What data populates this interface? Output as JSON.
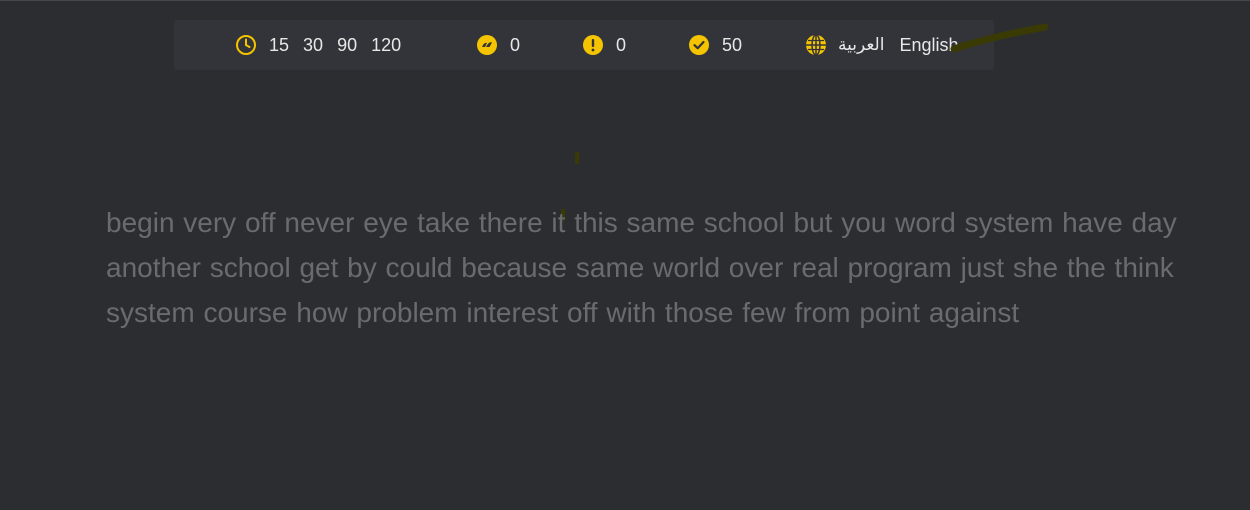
{
  "toolbar": {
    "time_icon": "clock-icon",
    "time_options": [
      "15",
      "30",
      "90",
      "120"
    ],
    "wpm_icon": "speed-icon",
    "wpm_value": "0",
    "errors_icon": "exclamation-icon",
    "errors_value": "0",
    "correct_icon": "check-icon",
    "correct_value": "50",
    "language_icon": "globe-icon",
    "language_arabic": "العربية",
    "language_english": "English"
  },
  "typing_text": "begin very off never eye take there it this same school but you word system have day another school get by could because same world over real program just she the think system course how problem interest off with those few from point against",
  "colors": {
    "background": "#2c2d31",
    "toolbar_bg": "#333439",
    "accent": "#f5c400",
    "text_pending": "#6a6b70",
    "text_bright": "#e8e8e8"
  }
}
